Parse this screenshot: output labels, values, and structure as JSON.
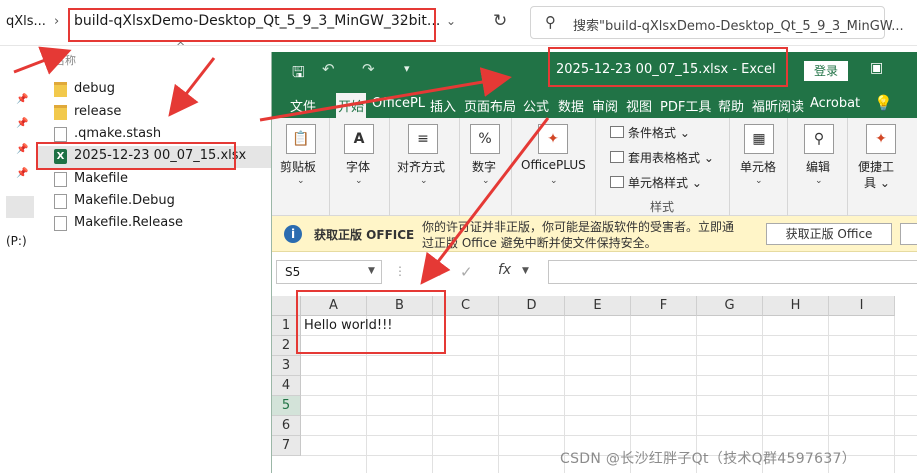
{
  "explorer": {
    "address_prefix": "qXls...",
    "address_chevron": "›",
    "address_path": "build-qXlsxDemo-Desktop_Qt_5_9_3_MinGW_32bit...",
    "address_path_chevron": "›",
    "dropdown_glyph": "⌄",
    "refresh_glyph": "↻",
    "search_placeholder": "搜索\"build-qXlsxDemo-Desktop_Qt_5_9_3_MinGW...",
    "sort_chevron": "^",
    "name_header": "名称",
    "drive_label": "(P:)",
    "files": [
      {
        "name": "debug",
        "icon": "folder-icon"
      },
      {
        "name": "release",
        "icon": "folder-icon"
      },
      {
        "name": ".qmake.stash",
        "icon": "file-icon"
      },
      {
        "name": "2025-12-23 00_07_15.xlsx",
        "icon": "excel-file-icon"
      },
      {
        "name": "Makefile",
        "icon": "file-icon"
      },
      {
        "name": "Makefile.Debug",
        "icon": "file-icon"
      },
      {
        "name": "Makefile.Release",
        "icon": "file-icon"
      }
    ]
  },
  "excel": {
    "title": "2025-12-23 00_07_15.xlsx  -  Excel",
    "login": "登录",
    "tabs": [
      "文件",
      "开始",
      "OfficePL",
      "插入",
      "页面布局",
      "公式",
      "数据",
      "审阅",
      "视图",
      "PDF工具",
      "帮助",
      "福昕阅读",
      "Acrobat"
    ],
    "ribbon": {
      "clipboard": "剪贴板",
      "font": "字体",
      "alignment": "对齐方式",
      "number": "数字",
      "officeplus": "OfficePLUS",
      "conditional_format": "条件格式",
      "table_format": "套用表格格式",
      "cell_style": "单元格样式",
      "styles_group": "样式",
      "cells": "单元格",
      "editing": "编辑",
      "quick_tools_1": "便捷工",
      "quick_tools_2": "具",
      "dropdown_glyph": "⌄"
    },
    "notice": {
      "title": "获取正版 OFFICE",
      "line1": "你的许可证并非正版，你可能是盗版软件的受害者。立即通",
      "line2": "过正版 Office 避免中断并使文件保持安全。",
      "button": "获取正版 Office"
    },
    "formula_bar": {
      "name_box": "S5",
      "fx": "fx",
      "value": ""
    },
    "grid": {
      "columns": [
        "A",
        "B",
        "C",
        "D",
        "E",
        "F",
        "G",
        "H",
        "I"
      ],
      "rows": [
        "1",
        "2",
        "3",
        "4",
        "5",
        "6",
        "7"
      ],
      "active_row": "5",
      "cell_A1": "Hello world!!!"
    },
    "colors": {
      "accent": "#217346",
      "highlight": "#e53935"
    }
  },
  "watermark": "CSDN @长沙红胖子Qt（技术Q群4597637）"
}
